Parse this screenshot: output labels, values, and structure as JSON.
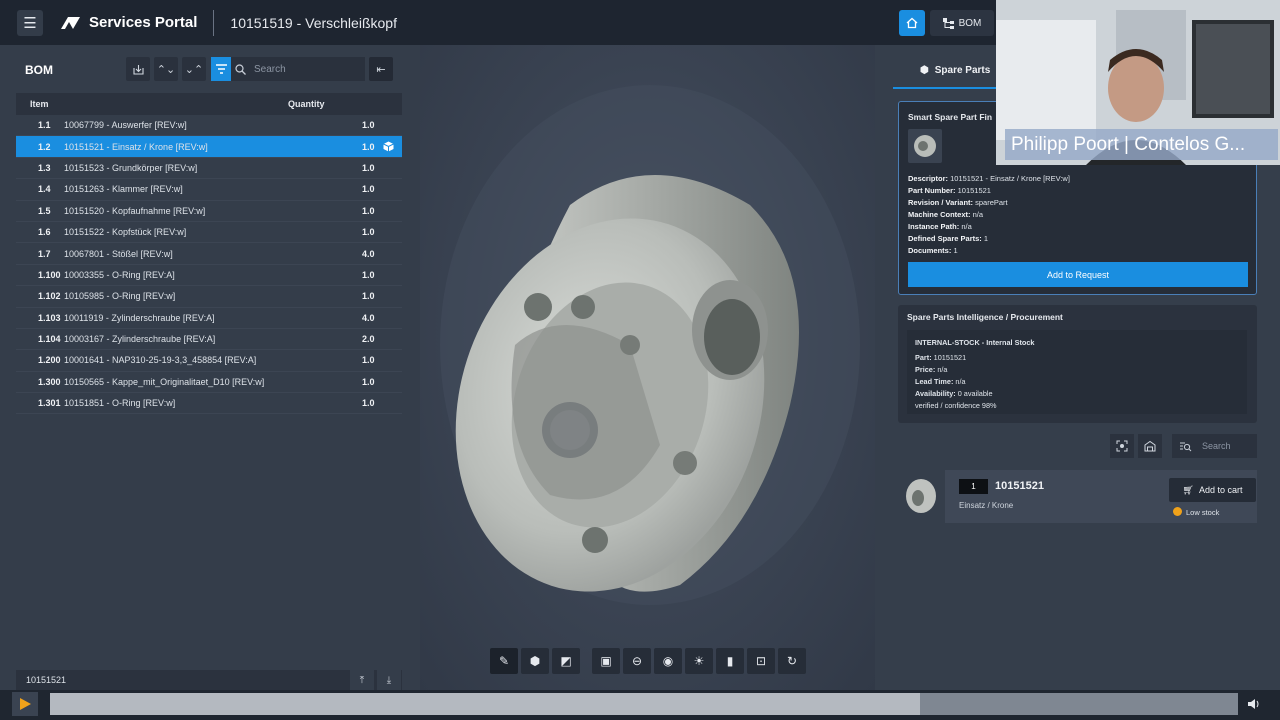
{
  "app": {
    "brand": "Services Portal",
    "document_title": "10151519 - Verschleißkopf",
    "nav_bom_label": "BOM"
  },
  "bom": {
    "title": "BOM",
    "search_placeholder": "Search",
    "columns": {
      "item": "Item",
      "quantity": "Quantity"
    },
    "rows": [
      {
        "num": "1.1",
        "name": "10067799 - Auswerfer [REV:w]",
        "qty": "1.0"
      },
      {
        "num": "1.2",
        "name": "10151521 - Einsatz / Krone [REV:w]",
        "qty": "1.0"
      },
      {
        "num": "1.3",
        "name": "10151523 - Grundkörper [REV:w]",
        "qty": "1.0"
      },
      {
        "num": "1.4",
        "name": "10151263 - Klammer [REV:w]",
        "qty": "1.0"
      },
      {
        "num": "1.5",
        "name": "10151520 - Kopfaufnahme [REV:w]",
        "qty": "1.0"
      },
      {
        "num": "1.6",
        "name": "10151522 - Kopfstück [REV:w]",
        "qty": "1.0"
      },
      {
        "num": "1.7",
        "name": "10067801 - Stößel [REV:w]",
        "qty": "4.0"
      },
      {
        "num": "1.100",
        "name": "10003355 - O-Ring [REV:A]",
        "qty": "1.0"
      },
      {
        "num": "1.102",
        "name": "10105985 - O-Ring [REV:w]",
        "qty": "1.0"
      },
      {
        "num": "1.103",
        "name": "10011919 - Zylinderschraube [REV:A]",
        "qty": "4.0"
      },
      {
        "num": "1.104",
        "name": "10003167 - Zylinderschraube [REV:A]",
        "qty": "2.0"
      },
      {
        "num": "1.200",
        "name": "10001641 - NAP310-25-19-3,3_458854 [REV:A]",
        "qty": "1.0"
      },
      {
        "num": "1.300",
        "name": "10150565 - Kappe_mit_Originalitaet_D10 [REV:w]",
        "qty": "1.0"
      },
      {
        "num": "1.301",
        "name": "10151851 - O-Ring [REV:w]",
        "qty": "1.0"
      }
    ],
    "footer_value": "10151521"
  },
  "spare_parts": {
    "tab_label": "Spare Parts",
    "finder": {
      "title": "Smart Spare Part Fin",
      "descriptor_label": "Descriptor:",
      "descriptor": "10151521 - Einsatz / Krone [REV:w]",
      "part_number_label": "Part Number:",
      "part_number": "10151521",
      "revision_label": "Revision / Variant:",
      "revision": "sparePart",
      "machine_label": "Machine Context:",
      "machine": "n/a",
      "instance_label": "Instance Path:",
      "instance": "n/a",
      "defined_label": "Defined Spare Parts:",
      "defined": "1",
      "documents_label": "Documents:",
      "documents": "1",
      "request_button": "Add to Request"
    },
    "intelligence": {
      "title": "Spare Parts Intelligence / Procurement",
      "source": "INTERNAL-STOCK - Internal Stock",
      "part_label": "Part:",
      "part": "10151521",
      "price_label": "Price:",
      "price": "n/a",
      "lead_label": "Lead Time:",
      "lead": "n/a",
      "availability_label": "Availability:",
      "availability": "0 available",
      "confidence": "verified / confidence 98%"
    },
    "search_placeholder": "Search",
    "cart": {
      "quantity": "1",
      "part": "10151521",
      "description": "Einsatz / Krone",
      "add_button": "Add to cart",
      "stock_status": "Low stock",
      "stock_color": "#f0a21a"
    }
  },
  "webcam": {
    "caption": "Philipp Poort | Contelos G..."
  },
  "player": {
    "progress": 0.732
  },
  "colors": {
    "accent": "#1a8ee0",
    "topbar": "#1e2530",
    "panel": "#343d4a"
  }
}
